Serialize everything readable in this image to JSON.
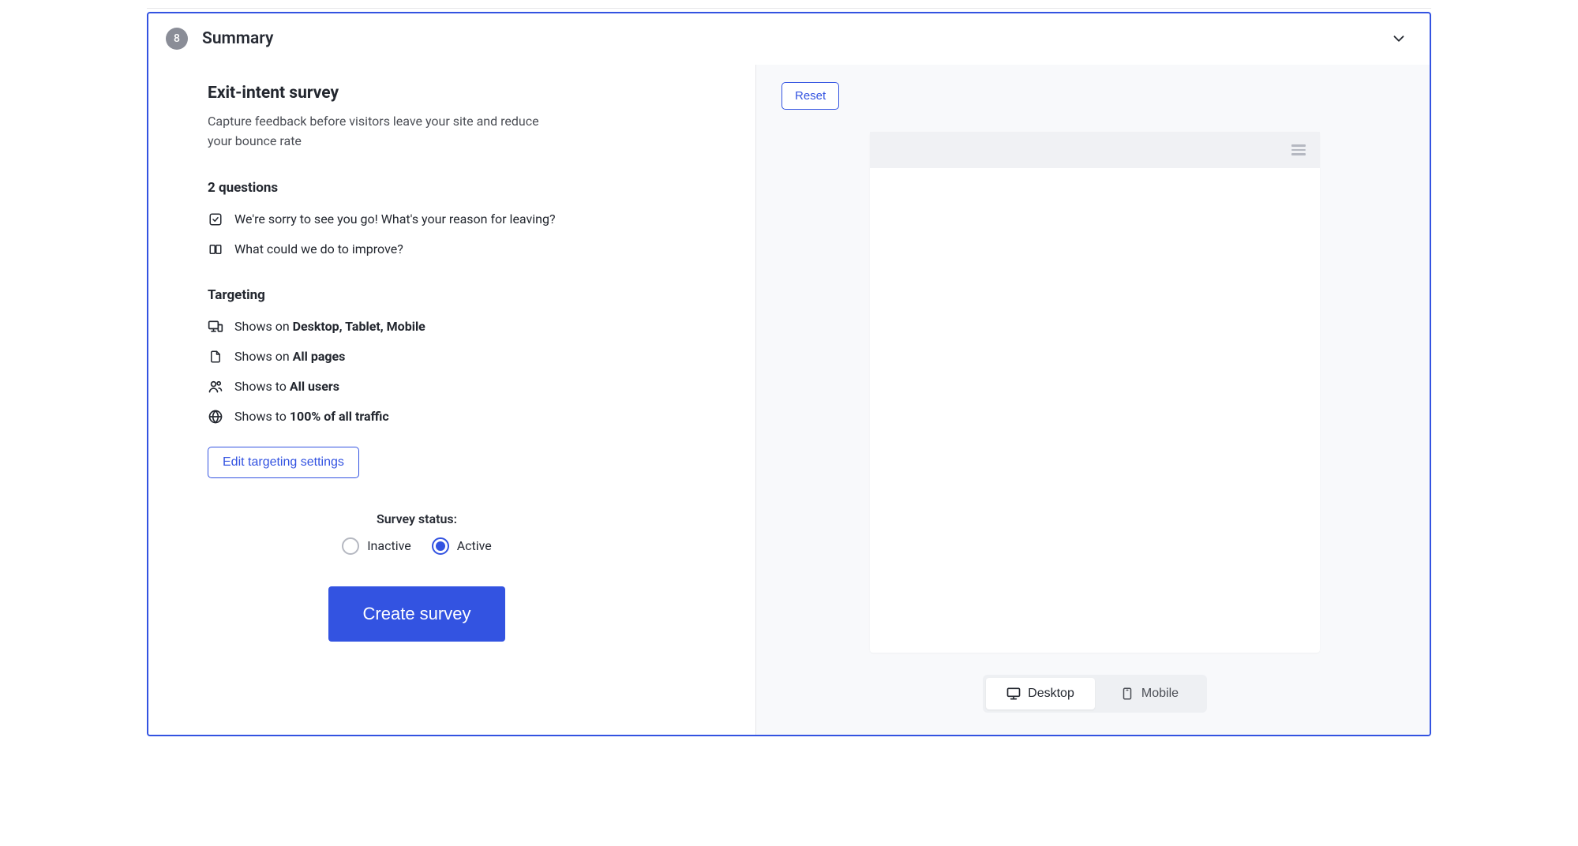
{
  "header": {
    "step_number": "8",
    "title": "Summary"
  },
  "summary": {
    "survey_title": "Exit-intent survey",
    "survey_description": "Capture feedback before visitors leave your site and reduce your bounce rate",
    "questions_heading": "2 questions",
    "questions": [
      {
        "text": "We're sorry to see you go! What's your reason for leaving?"
      },
      {
        "text": "What could we do to improve?"
      }
    ],
    "targeting_heading": "Targeting",
    "targeting": {
      "devices_prefix": "Shows on ",
      "devices_value": "Desktop, Tablet, Mobile",
      "pages_prefix": "Shows on ",
      "pages_value": "All pages",
      "audience_prefix": "Shows to ",
      "audience_value": "All users",
      "traffic_prefix": "Shows to ",
      "traffic_value": "100% of all traffic"
    },
    "edit_targeting_label": "Edit targeting settings",
    "status_label": "Survey status:",
    "status_options": {
      "inactive": "Inactive",
      "active": "Active"
    },
    "create_button_label": "Create survey"
  },
  "right": {
    "reset_label": "Reset",
    "view_toggle": {
      "desktop": "Desktop",
      "mobile": "Mobile"
    }
  }
}
